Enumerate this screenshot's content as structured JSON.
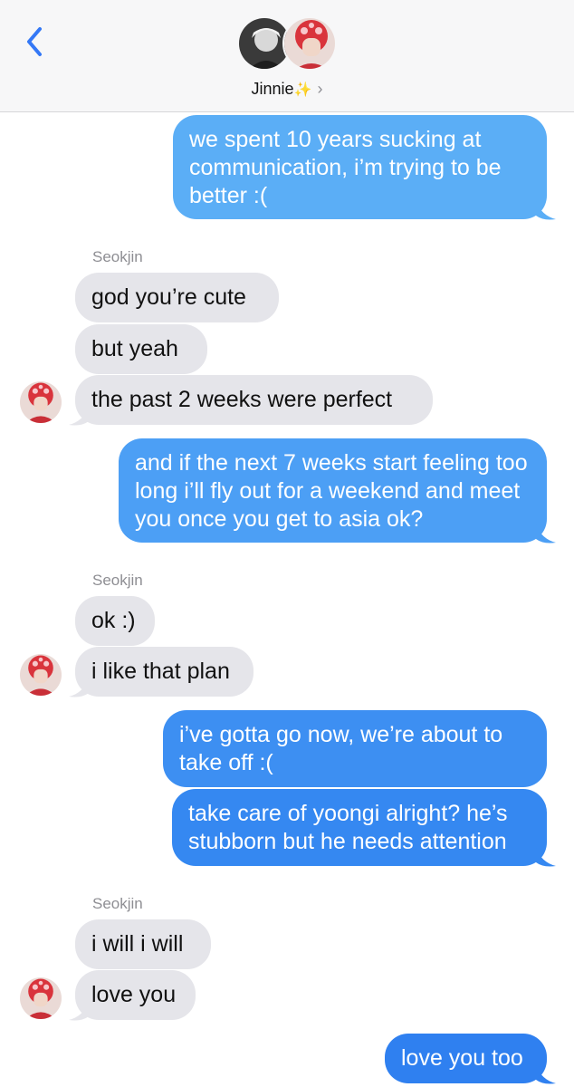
{
  "header": {
    "contact_name": "Jinnie",
    "sparkle": "✨",
    "chevron": "›",
    "back_icon": "chevron-left-icon"
  },
  "colors": {
    "sent_top": "#5eb0f6",
    "sent_bottom": "#2f7ff0",
    "received": "#e5e5ea",
    "accent": "#3478f6"
  },
  "messages": [
    {
      "side": "out",
      "text": "we spent 10 years sucking at communication, i’m trying to be better :("
    },
    {
      "side": "in",
      "sender": "Seokjin",
      "text": "god you’re cute"
    },
    {
      "side": "in",
      "text": "but yeah"
    },
    {
      "side": "in",
      "text": "the past 2 weeks were perfect"
    },
    {
      "side": "out",
      "text": "and if the next 7 weeks start feeling too long i’ll fly out for a weekend and meet you once you get to asia ok?"
    },
    {
      "side": "in",
      "sender": "Seokjin",
      "text": "ok :)"
    },
    {
      "side": "in",
      "text": "i like that plan"
    },
    {
      "side": "out",
      "text": "i’ve gotta go now, we’re about to take off :("
    },
    {
      "side": "out",
      "text": "take care of yoongi alright? he’s stubborn but he needs attention"
    },
    {
      "side": "in",
      "sender": "Seokjin",
      "text": "i will i will"
    },
    {
      "side": "in",
      "text": "love you"
    },
    {
      "side": "out",
      "text": "love you too"
    }
  ]
}
